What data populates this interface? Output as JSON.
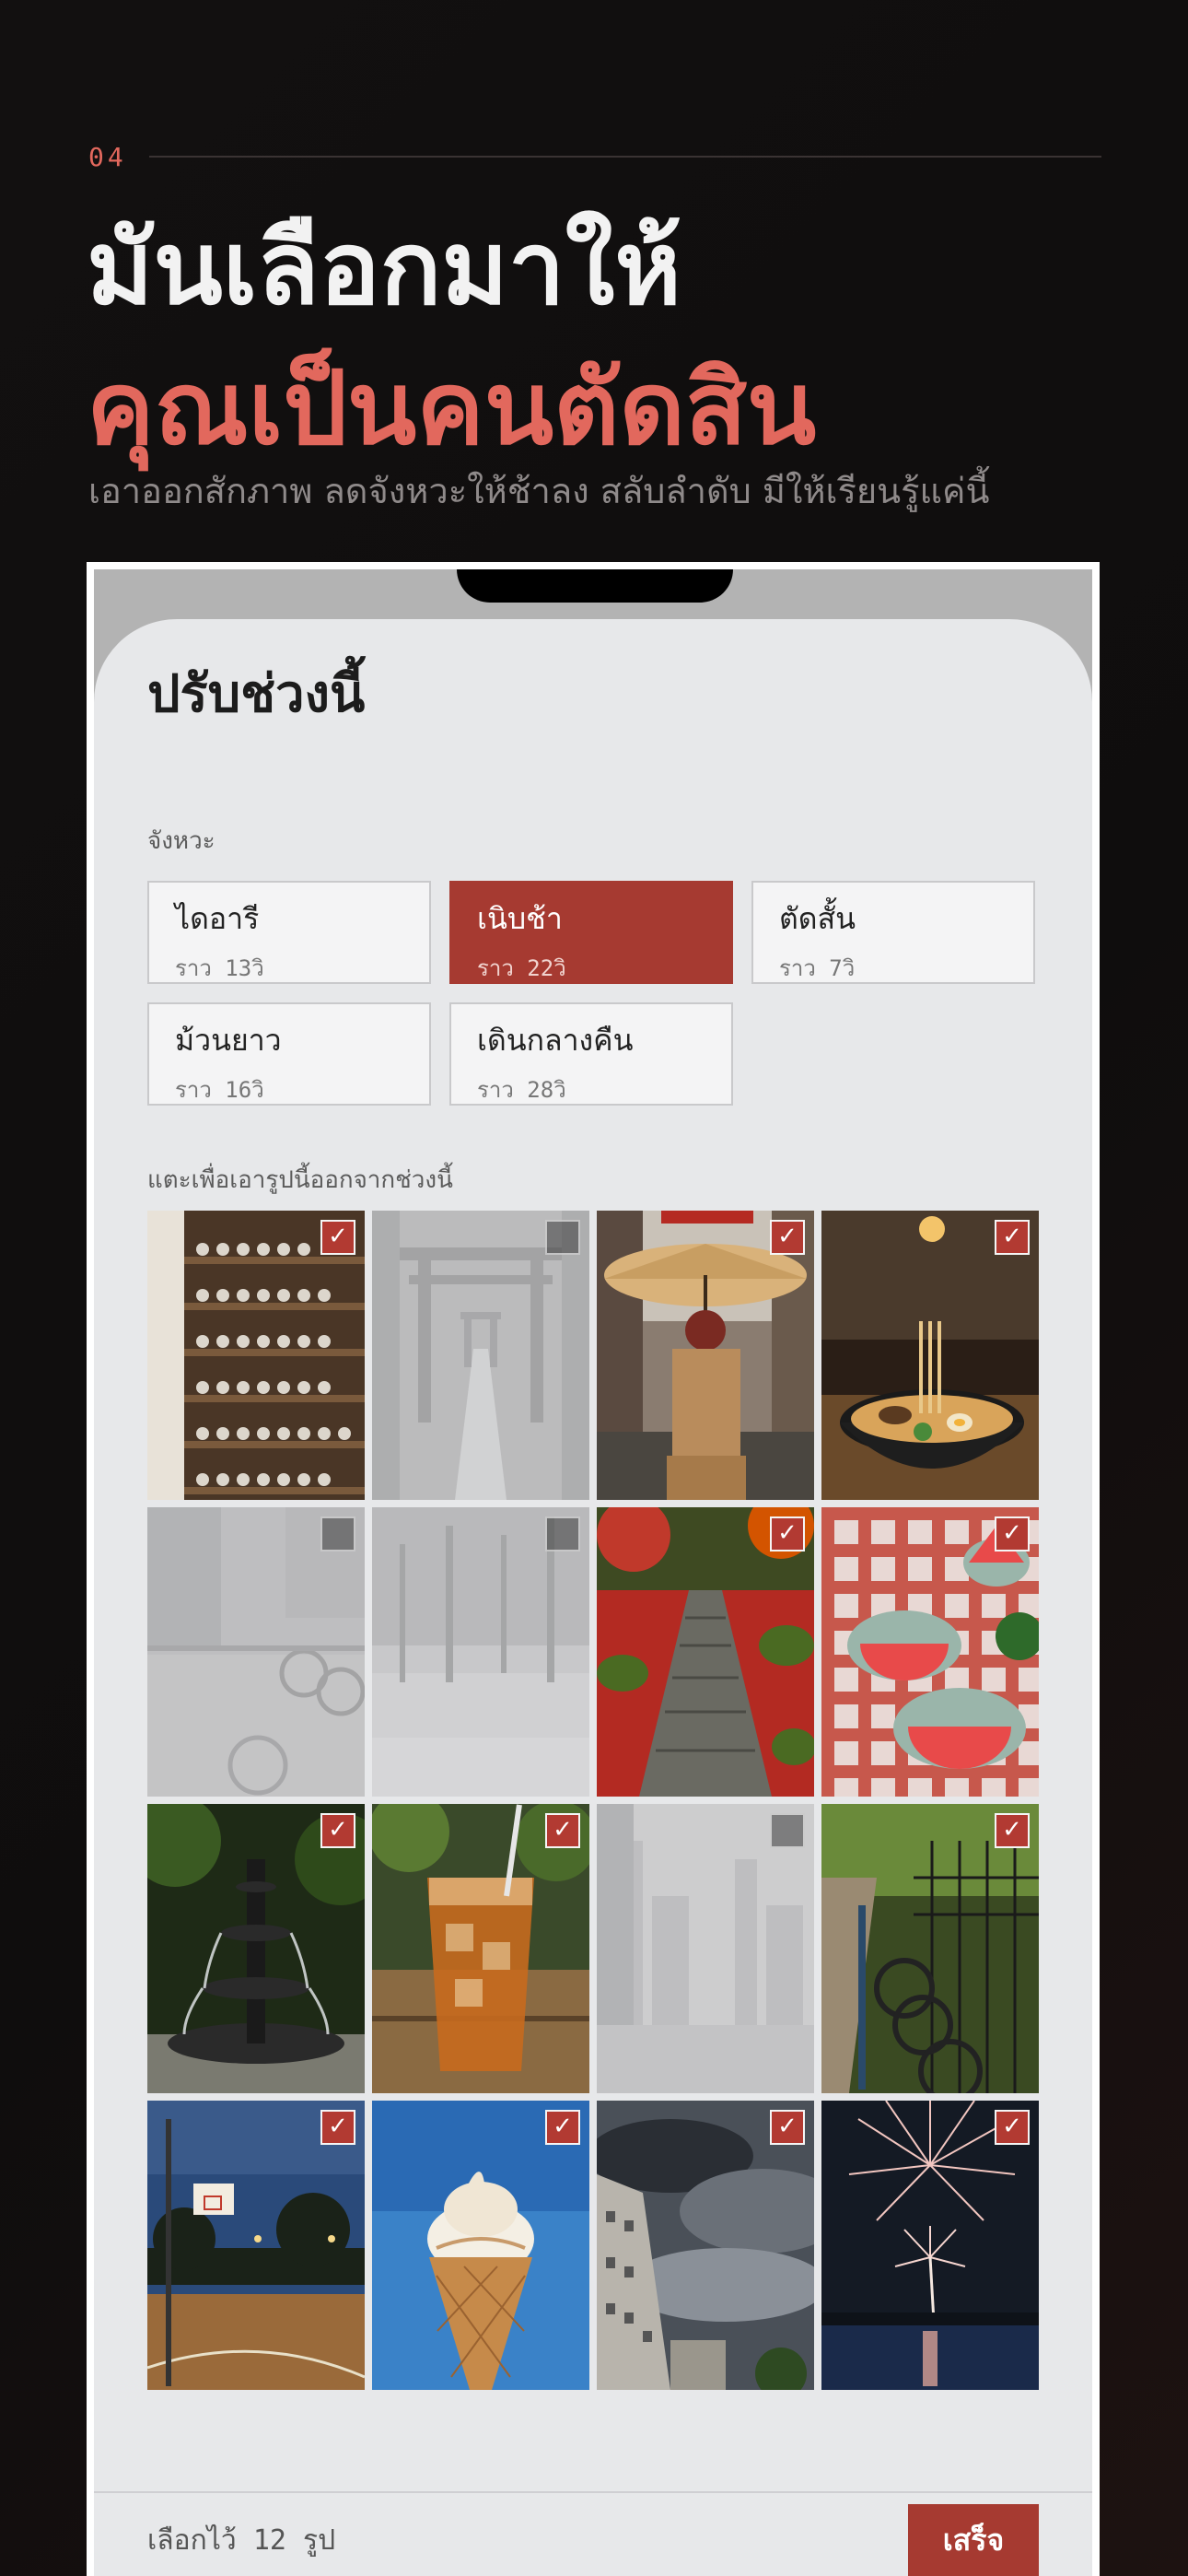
{
  "header": {
    "step": "04",
    "title_line1": "มันเลือกมาให้",
    "title_line2": "คุณเป็นคนตัดสิน",
    "subtitle": "เอาออกสักภาพ ลดจังหวะให้ช้าลง สลับลำดับ มีให้เรียนรู้แค่นี้"
  },
  "sheet": {
    "title": "ปรับช่วงนี้",
    "tempo_label": "จังหวะ",
    "tempo_options": [
      {
        "label": "ไดอารี",
        "duration": "ราว 13วิ",
        "selected": false
      },
      {
        "label": "เนิบช้า",
        "duration": "ราว 22วิ",
        "selected": true
      },
      {
        "label": "ตัดสั้น",
        "duration": "ราว 7วิ",
        "selected": false
      },
      {
        "label": "ม้วนยาว",
        "duration": "ราว 16วิ",
        "selected": false
      },
      {
        "label": "เดินกลางคืน",
        "duration": "ราว 28วิ",
        "selected": false
      }
    ],
    "photos_label": "แตะเพื่อเอารูปนี้ออกจากช่วงนี้",
    "photos": [
      {
        "subject": "teacup-shelves",
        "selected": true
      },
      {
        "subject": "torii-gate-path",
        "selected": false
      },
      {
        "subject": "umbrella-street",
        "selected": true
      },
      {
        "subject": "ramen-bowl",
        "selected": true
      },
      {
        "subject": "canal-bicycles",
        "selected": false
      },
      {
        "subject": "park-trees",
        "selected": false
      },
      {
        "subject": "maple-stone-path",
        "selected": true
      },
      {
        "subject": "watermelon-picnic",
        "selected": true
      },
      {
        "subject": "park-fountain",
        "selected": true
      },
      {
        "subject": "iced-tea",
        "selected": true
      },
      {
        "subject": "foggy-city",
        "selected": false
      },
      {
        "subject": "bikes-railing",
        "selected": true
      },
      {
        "subject": "basketball-court",
        "selected": true
      },
      {
        "subject": "ice-cream-cone",
        "selected": true
      },
      {
        "subject": "storm-buildings",
        "selected": true
      },
      {
        "subject": "fireworks-lake",
        "selected": true
      }
    ],
    "check_glyph": "✓"
  },
  "footer": {
    "selected_count": "เลือกไว้ 12 รูป",
    "done_label": "เสร็จ"
  },
  "colors": {
    "accent": "#a63a31",
    "accent_text": "#e2685d",
    "background": "#121010",
    "sheet": "#e7e8ea"
  }
}
